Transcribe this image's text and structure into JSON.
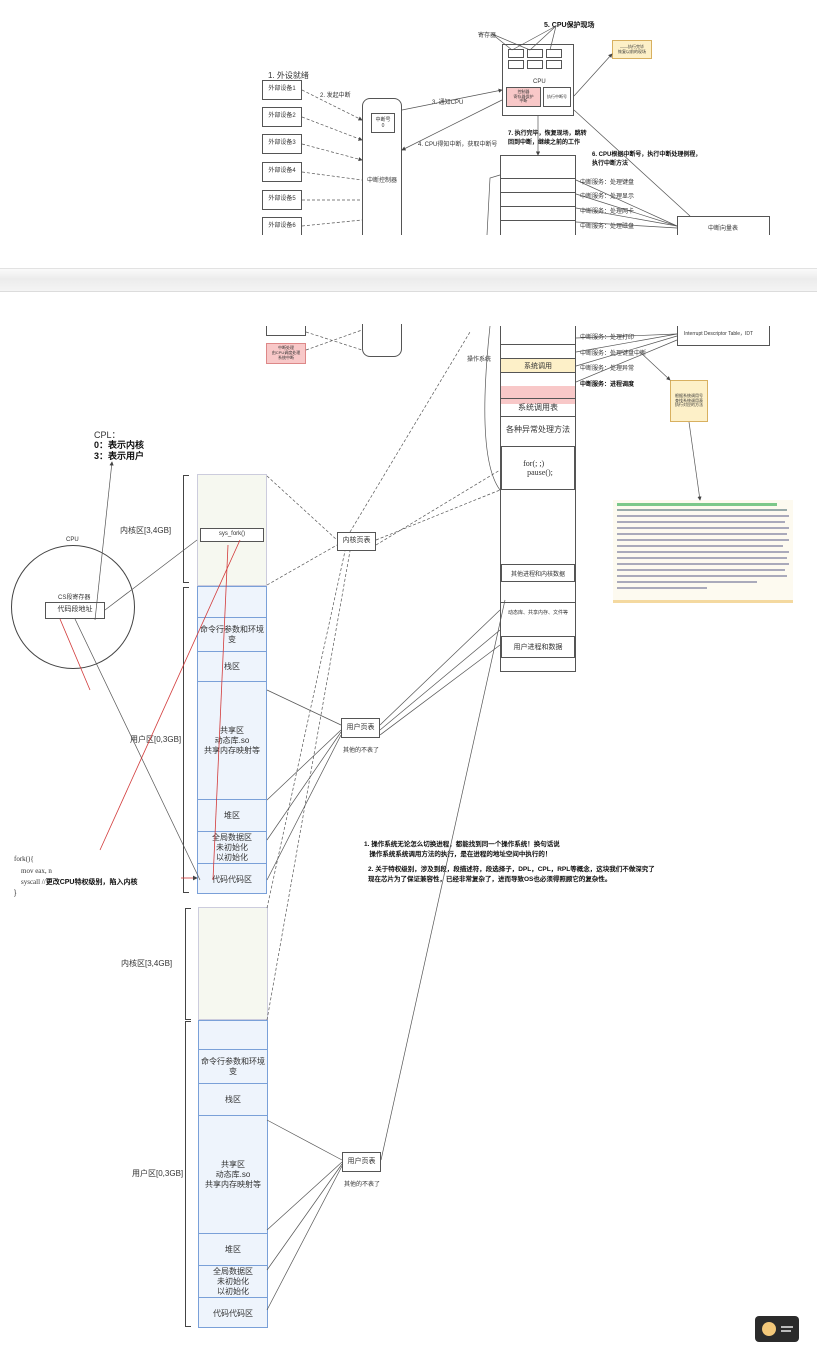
{
  "top_diagram": {
    "step1_label": "1. 外设就绪",
    "devices": [
      "外部设备1",
      "外部设备2",
      "外部设备3",
      "外部设备4",
      "外部设备5",
      "外部设备6"
    ],
    "step2_label": "2. 发起中断",
    "controller": {
      "reg_label": "中断号\n0",
      "name": "中断控制器"
    },
    "step3_label": "3. 通知CPU",
    "step4_label": "4. CPU得知中断，获取中断号",
    "step5_label": "5. CPU保护现场",
    "registers_label": "寄存器",
    "cpu_label": "CPU",
    "cpu_chip_left": "控制器\n寄存器保护\n中断",
    "cpu_chip_right": "执行中断号",
    "note_box": "——执行完毕\n恢复以前的现场",
    "step7_label": "7. 执行完毕，恢复现场，跳转\n回到中断，继续之前的工作",
    "step6_label": "6. CPU根据中断号，执行中断处理例程，\n执行中断方法",
    "isr_rows_top": [
      "中断服务：处理键盘",
      "中断服务：处理显示",
      "中断服务：处理网卡",
      "中断服务：处理磁盘"
    ],
    "idt_label": "中断向量表",
    "idt_note": "Interrupt Descriptor Table，IDT"
  },
  "continuation": {
    "isr_rows": [
      "中断服务：处理打印",
      "中断服务：处理键盘中断",
      "中断服务：处理异常",
      "中断服务：进程调度"
    ],
    "syscall_cell": "系统调用",
    "os_label": "操作系统",
    "pink_box": "中断处理\n由CPU调度处理\n系统中断",
    "yellow_note": "根据系统调用号\n查找系统调用表\n执行对应的方法",
    "syscall_table": "系统调用表",
    "exception_methods": "各种异常处理方法",
    "loop_code": "for(; ;)\n  pause();",
    "kernel_data": "其他进程和内核数据",
    "files": "动态库、共享内存、文件等",
    "user_proc_data": "用户进程和数据"
  },
  "cpl_note": {
    "title": "CPL：",
    "line0": "0：表示内核",
    "line3": "3：表示用户"
  },
  "cpu_circle": {
    "title": "CPU",
    "register": "CS段寄存器",
    "field": "代码段地址"
  },
  "process1": {
    "kernel_label": "内核区[3,4GB]",
    "sys_fork": "sys_fork()",
    "user_label": "用户区[0,3GB]",
    "segments": [
      "命令行参数和环境变",
      "栈区",
      "共享区\n动态库.so\n共享内存映射等",
      "堆区",
      "全局数据区\n未初始化\n以初始化",
      "代码代码区"
    ]
  },
  "kernel_page_table": "内核页表",
  "user_page_table_1": "用户页表",
  "user_page_note_1": "其他的不表了",
  "fork_code": "fork(){\n    mov eax, n\n    syscall //",
  "fork_comment": "更改CPU特权级别，陷入内核",
  "fork_close": "}",
  "notes": [
    "1. 操作系统无论怎么切换进程，都能找到同一个操作系统！换句话说\n   操作系统系统调用方法的执行，是在进程的地址空间中执行的！",
    "2. 关于特权级别，涉及到段，段描述符，段选择子，DPL，CPL，RPL等概念，这块我们不做深究了\n现在芯片为了保证兼容性，已经非常复杂了，进而导致OS也必须得照顾它的复杂性。"
  ],
  "process2": {
    "kernel_label": "内核区[3,4GB]",
    "user_label": "用户区[0,3GB]",
    "segments": [
      "命令行参数和环境变",
      "栈区",
      "共享区\n动态库.so\n共享内存映射等",
      "堆区",
      "全局数据区\n未初始化\n以初始化",
      "代码代码区"
    ]
  },
  "user_page_table_2": "用户页表",
  "user_page_note_2": "其他的不表了",
  "colors": {
    "kernel_fill": "#f6f8f0",
    "user_fill": "#eef4fc",
    "user_border": "#7aa0d8",
    "red_line": "#d23a3a",
    "pink": "#f8c8c8",
    "yellow": "#fdf0c8",
    "code_green": "#2e9e3e"
  }
}
